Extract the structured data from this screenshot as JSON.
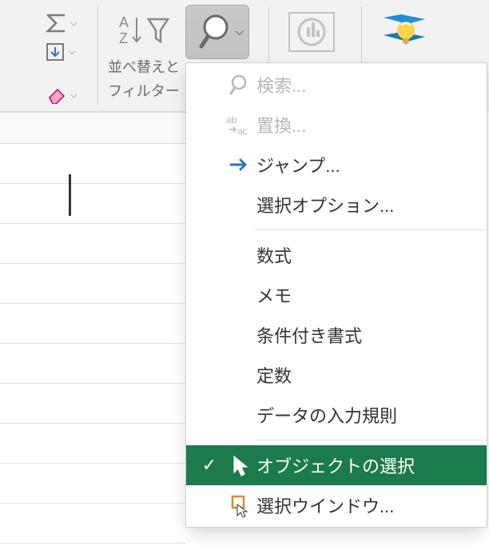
{
  "ribbon": {
    "sort_filter_label_line1": "並べ替えと",
    "sort_filter_label_line2": "フィルター"
  },
  "menu": {
    "items": [
      {
        "label": "検索...",
        "icon": "search",
        "disabled": true
      },
      {
        "label": "置換...",
        "icon": "replace",
        "disabled": true
      },
      {
        "label": "ジャンプ...",
        "icon": "jump",
        "disabled": false
      },
      {
        "label": "選択オプション...",
        "icon": "",
        "disabled": false
      },
      {
        "label": "数式",
        "icon": "",
        "disabled": false,
        "sep_before": true
      },
      {
        "label": "メモ",
        "icon": "",
        "disabled": false
      },
      {
        "label": "条件付き書式",
        "icon": "",
        "disabled": false
      },
      {
        "label": "定数",
        "icon": "",
        "disabled": false
      },
      {
        "label": "データの入力規則",
        "icon": "",
        "disabled": false
      },
      {
        "label": "オブジェクトの選択",
        "icon": "pointer",
        "disabled": false,
        "sep_before": true,
        "selected": true
      },
      {
        "label": "選択ウインドウ...",
        "icon": "selpane",
        "disabled": false
      }
    ]
  }
}
